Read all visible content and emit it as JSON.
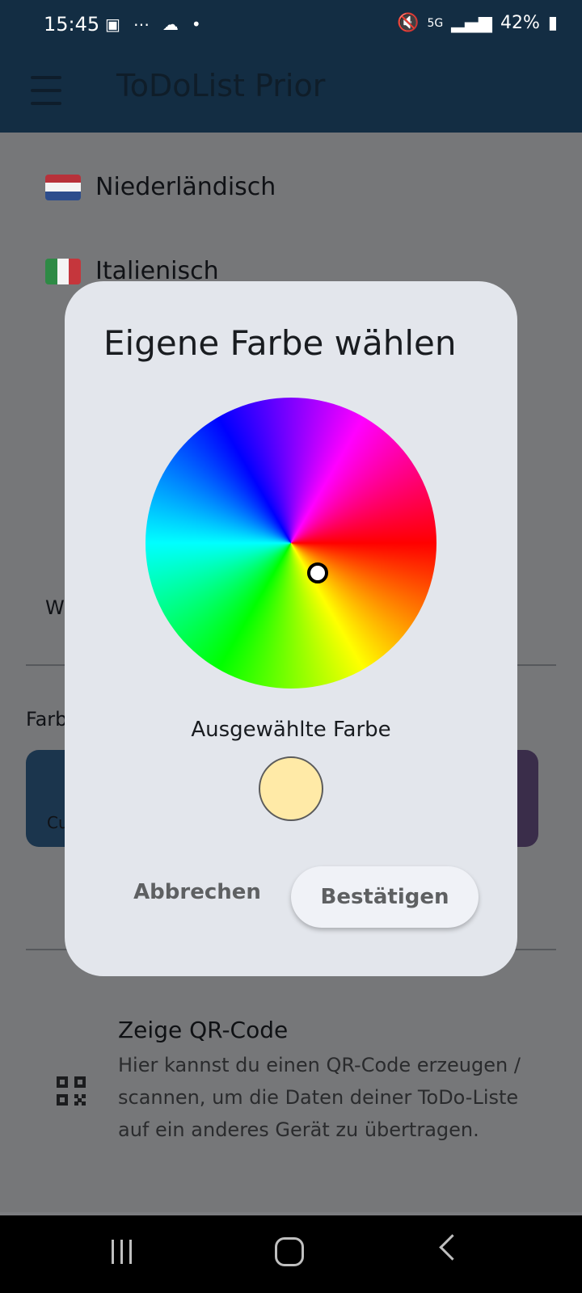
{
  "status_bar": {
    "time": "15:45",
    "battery": "42%",
    "network": "5G"
  },
  "app_bar": {
    "title": "ToDoList Prior"
  },
  "languages": [
    {
      "label": "Niederländisch",
      "flag": "flag-netherlands"
    },
    {
      "label": "Italienisch",
      "flag": "flag-italy"
    }
  ],
  "background": {
    "section_label_partial": "Farb",
    "card_partial_text": "Cu",
    "row_partial_text": "W"
  },
  "qr": {
    "title": "Zeige QR-Code",
    "description": "Hier kannst du einen QR-Code erzeugen / scannen, um die Daten deiner ToDo-Liste auf ein anderes Gerät zu übertragen."
  },
  "dialog": {
    "title": "Eigene Farbe wählen",
    "selected_label": "Ausgewählte Farbe",
    "selected_color": "#ffeaa7",
    "cancel_label": "Abbrechen",
    "confirm_label": "Bestätigen"
  }
}
